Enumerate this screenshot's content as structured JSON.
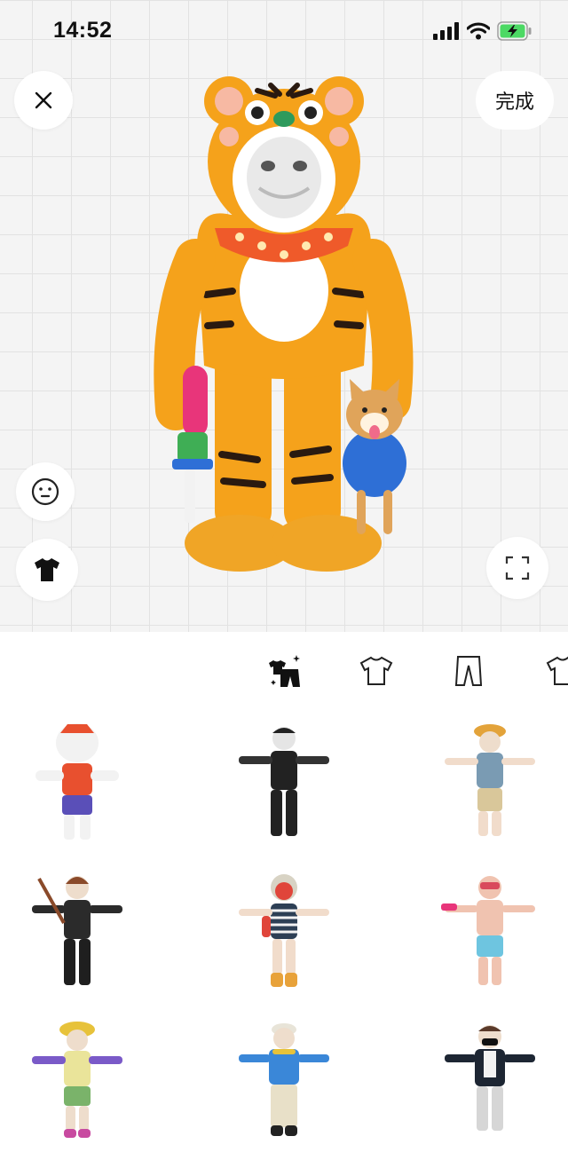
{
  "status_bar": {
    "time": "14:52",
    "icons": [
      "cellular-signal-icon",
      "wifi-icon",
      "battery-charging-icon"
    ],
    "battery_color": "#4cd964"
  },
  "header": {
    "close_icon": "close-icon",
    "done_label": "完成"
  },
  "side_controls": {
    "face_icon": "face-icon",
    "outfit_icon": "tshirt-icon",
    "fullscreen_icon": "fullscreen-icon"
  },
  "avatar": {
    "description_icon": "tiger-costume-avatar",
    "accent_colors": {
      "costume": "#f5a21b",
      "stripes": "#2a1a10",
      "bandana": "#ef5a2a",
      "toy_gun": "#e8357a",
      "dog_shirt": "#2e6fd6"
    }
  },
  "category_tabs": [
    {
      "icon": "full-outfit-icon",
      "selected": true
    },
    {
      "icon": "top-shirt-icon",
      "selected": false
    },
    {
      "icon": "pants-icon",
      "selected": false
    },
    {
      "icon": "other-clothing-icon",
      "selected": false
    }
  ],
  "outfits": [
    {
      "name": "lion-dance-outfit",
      "colors": [
        "#f2f2f2",
        "#e8502f",
        "#5a4fb8"
      ]
    },
    {
      "name": "black-street-outfit",
      "colors": [
        "#222222",
        "#3a3a3a",
        "#222222"
      ]
    },
    {
      "name": "bucket-hat-vest-outfit",
      "colors": [
        "#e3a33a",
        "#7a9bb3",
        "#d9c79a"
      ]
    },
    {
      "name": "guitarist-outfit",
      "colors": [
        "#8a4a2a",
        "#2b2b2b",
        "#1f1f1f"
      ]
    },
    {
      "name": "striped-shirt-outfit",
      "colors": [
        "#d8d3c4",
        "#2d3f55",
        "#e8a23a"
      ]
    },
    {
      "name": "snorkel-beach-outfit",
      "colors": [
        "#d94a5c",
        "#f0c3b0",
        "#6ec5e0"
      ]
    },
    {
      "name": "yellow-hat-braids-outfit",
      "colors": [
        "#e7c23a",
        "#eae49a",
        "#7ab36a"
      ]
    },
    {
      "name": "blue-shirt-cap-outfit",
      "colors": [
        "#e8e4d8",
        "#3a87d8",
        "#e8e0c8"
      ]
    },
    {
      "name": "black-jacket-mask-outfit",
      "colors": [
        "#5a3a2a",
        "#1d2633",
        "#d6d6d6"
      ]
    }
  ]
}
